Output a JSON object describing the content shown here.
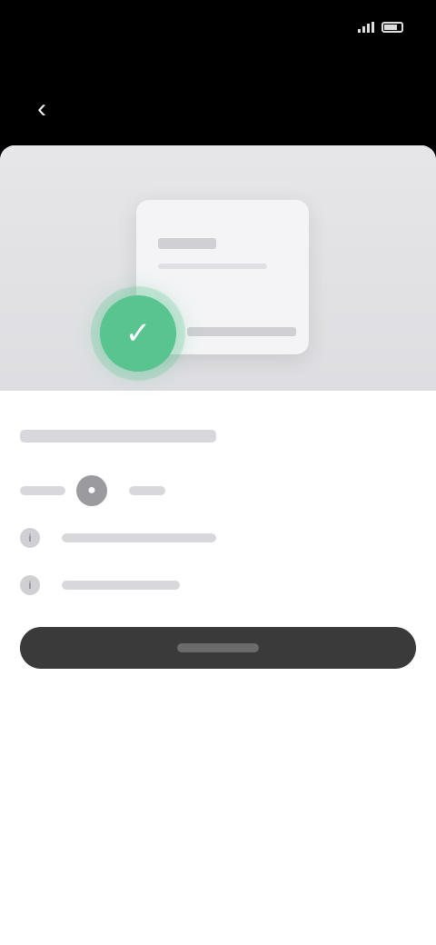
{
  "status_bar": {
    "time": "",
    "signal_icon": "signal-icon",
    "battery_icon": "battery-icon"
  },
  "top_bar": {
    "back_icon": "back-arrow-icon"
  },
  "illustration": {
    "accent_color": "#58c48f",
    "check_icon": "check-icon"
  },
  "content": {
    "headline": "",
    "rows": [
      {
        "icon": "avatar-icon",
        "text": ""
      },
      {
        "icon": "info-icon",
        "text": ""
      },
      {
        "icon": "info-icon",
        "text": ""
      }
    ]
  },
  "primary_button": {
    "label": "",
    "color": "#3a3a3a"
  }
}
